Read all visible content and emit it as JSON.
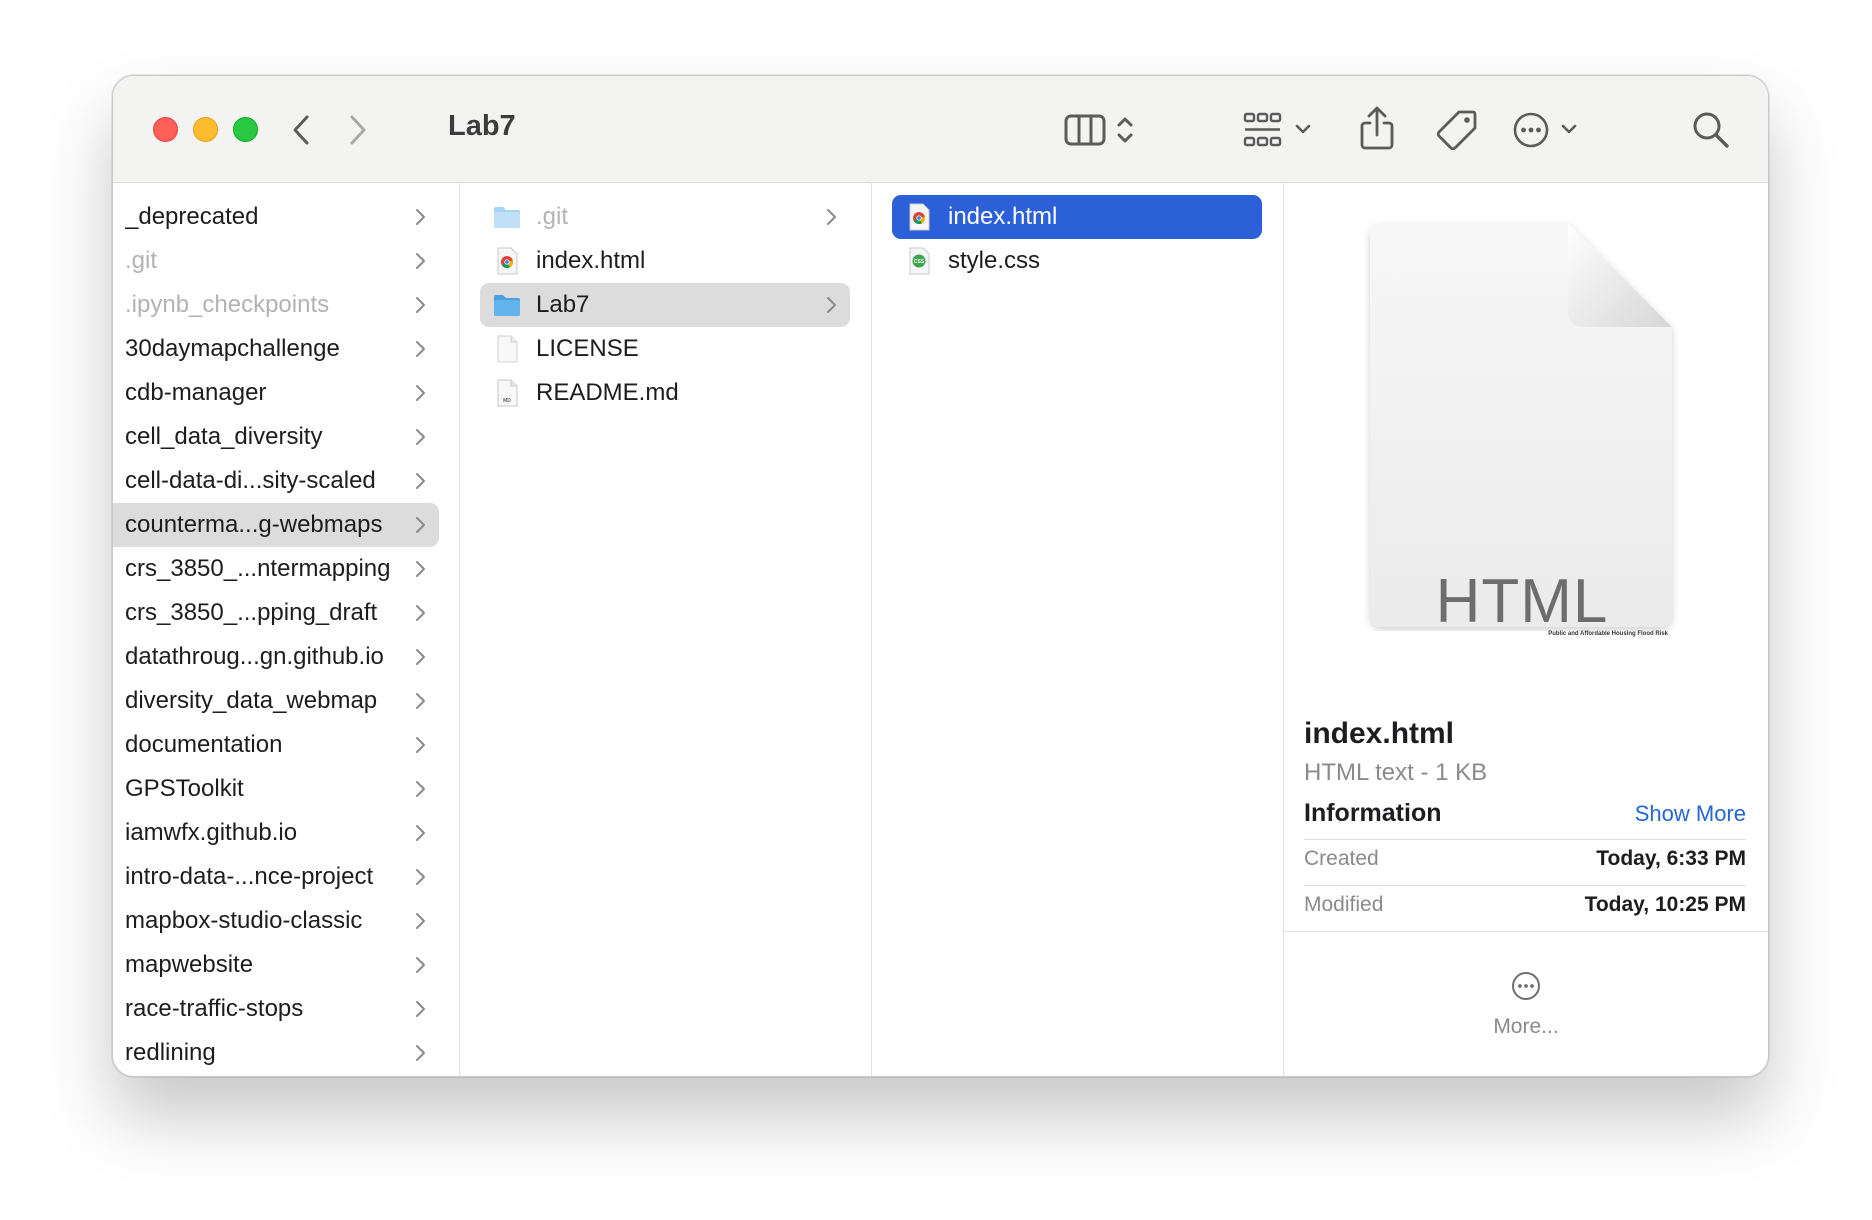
{
  "toolbar": {
    "title": "Lab7",
    "buttons": [
      {
        "name": "back-button",
        "icon": "chevron-left-icon"
      },
      {
        "name": "forward-button",
        "icon": "chevron-right-icon"
      },
      {
        "name": "view-mode-button",
        "icon": "columns-icon"
      },
      {
        "name": "group-button",
        "icon": "grid-icon"
      },
      {
        "name": "share-button",
        "icon": "share-icon"
      },
      {
        "name": "tag-button",
        "icon": "tag-icon"
      },
      {
        "name": "action-button",
        "icon": "ellipsis-circle-icon"
      },
      {
        "name": "search-button",
        "icon": "search-icon"
      }
    ]
  },
  "column1": {
    "items": [
      {
        "label": "_deprecated",
        "dim": false
      },
      {
        "label": ".git",
        "dim": true
      },
      {
        "label": ".ipynb_checkpoints",
        "dim": true
      },
      {
        "label": "30daymapchallenge",
        "dim": false
      },
      {
        "label": "cdb-manager",
        "dim": false
      },
      {
        "label": "cell_data_diversity",
        "dim": false
      },
      {
        "label": "cell-data-di...sity-scaled",
        "dim": false
      },
      {
        "label": "counterma...g-webmaps",
        "dim": false,
        "selected": true
      },
      {
        "label": "crs_3850_...ntermapping",
        "dim": false
      },
      {
        "label": "crs_3850_...pping_draft",
        "dim": false
      },
      {
        "label": "datathroug...gn.github.io",
        "dim": false
      },
      {
        "label": "diversity_data_webmap",
        "dim": false
      },
      {
        "label": "documentation",
        "dim": false
      },
      {
        "label": "GPSToolkit",
        "dim": false
      },
      {
        "label": "iamwfx.github.io",
        "dim": false
      },
      {
        "label": "intro-data-...nce-project",
        "dim": false
      },
      {
        "label": "mapbox-studio-classic",
        "dim": false
      },
      {
        "label": "mapwebsite",
        "dim": false
      },
      {
        "label": "race-traffic-stops",
        "dim": false
      },
      {
        "label": "redlining",
        "dim": false
      }
    ]
  },
  "column2": {
    "items": [
      {
        "label": ".git",
        "type": "folder",
        "dim": true,
        "has_children": true
      },
      {
        "label": "index.html",
        "type": "html",
        "dim": false,
        "has_children": false
      },
      {
        "label": "Lab7",
        "type": "folder",
        "dim": false,
        "has_children": true,
        "selected": true
      },
      {
        "label": "LICENSE",
        "type": "blank",
        "dim": false,
        "has_children": false
      },
      {
        "label": "README.md",
        "type": "md",
        "dim": false,
        "has_children": false
      }
    ]
  },
  "column3": {
    "items": [
      {
        "label": "index.html",
        "type": "html",
        "active": true
      },
      {
        "label": "style.css",
        "type": "css",
        "active": false
      }
    ]
  },
  "preview": {
    "doc_extension": "HTML",
    "doc_caption": "Public and Affordable Housing Flood Risk",
    "file_name": "index.html",
    "file_kind": "HTML text - 1 KB",
    "info_heading": "Information",
    "show_more": "Show More",
    "created_label": "Created",
    "created_value": "Today, 6:33 PM",
    "modified_label": "Modified",
    "modified_value": "Today, 10:25 PM",
    "more_label": "More..."
  },
  "colors": {
    "selection_active": "#2b60d9",
    "selection_inactive": "#dcdcdc",
    "link": "#2565d4",
    "folder": "#63b3ed"
  }
}
